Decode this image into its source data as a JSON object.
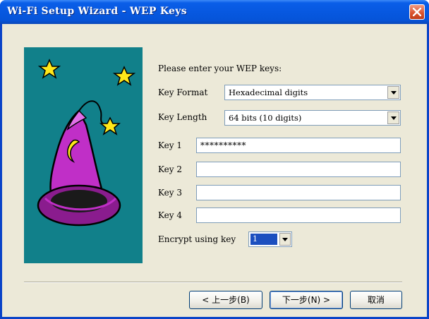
{
  "window": {
    "title": "Wi-Fi Setup Wizard - WEP Keys",
    "icon": "close-icon"
  },
  "banner": {
    "background": "#11808a",
    "image": "wizard-hat-with-stars"
  },
  "form": {
    "prompt": "Please enter your WEP keys:",
    "key_format": {
      "label": "Key Format",
      "value": "Hexadecimal digits"
    },
    "key_length": {
      "label": "Key Length",
      "value": "64 bits (10 digits)"
    },
    "keys": [
      {
        "label": "Key 1",
        "value": "**********"
      },
      {
        "label": "Key 2",
        "value": ""
      },
      {
        "label": "Key 3",
        "value": ""
      },
      {
        "label": "Key 4",
        "value": ""
      }
    ],
    "encrypt_using": {
      "label": "Encrypt using key",
      "value": "1"
    }
  },
  "buttons": {
    "back": "< 上一步(B)",
    "next": "下一步(N) >",
    "cancel": "取消"
  },
  "colors": {
    "titlebar": "#0758e0",
    "dialog_bg": "#ece9d8",
    "banner_bg": "#11808a",
    "close_button": "#d8502a",
    "selection": "#1c4fbf"
  }
}
